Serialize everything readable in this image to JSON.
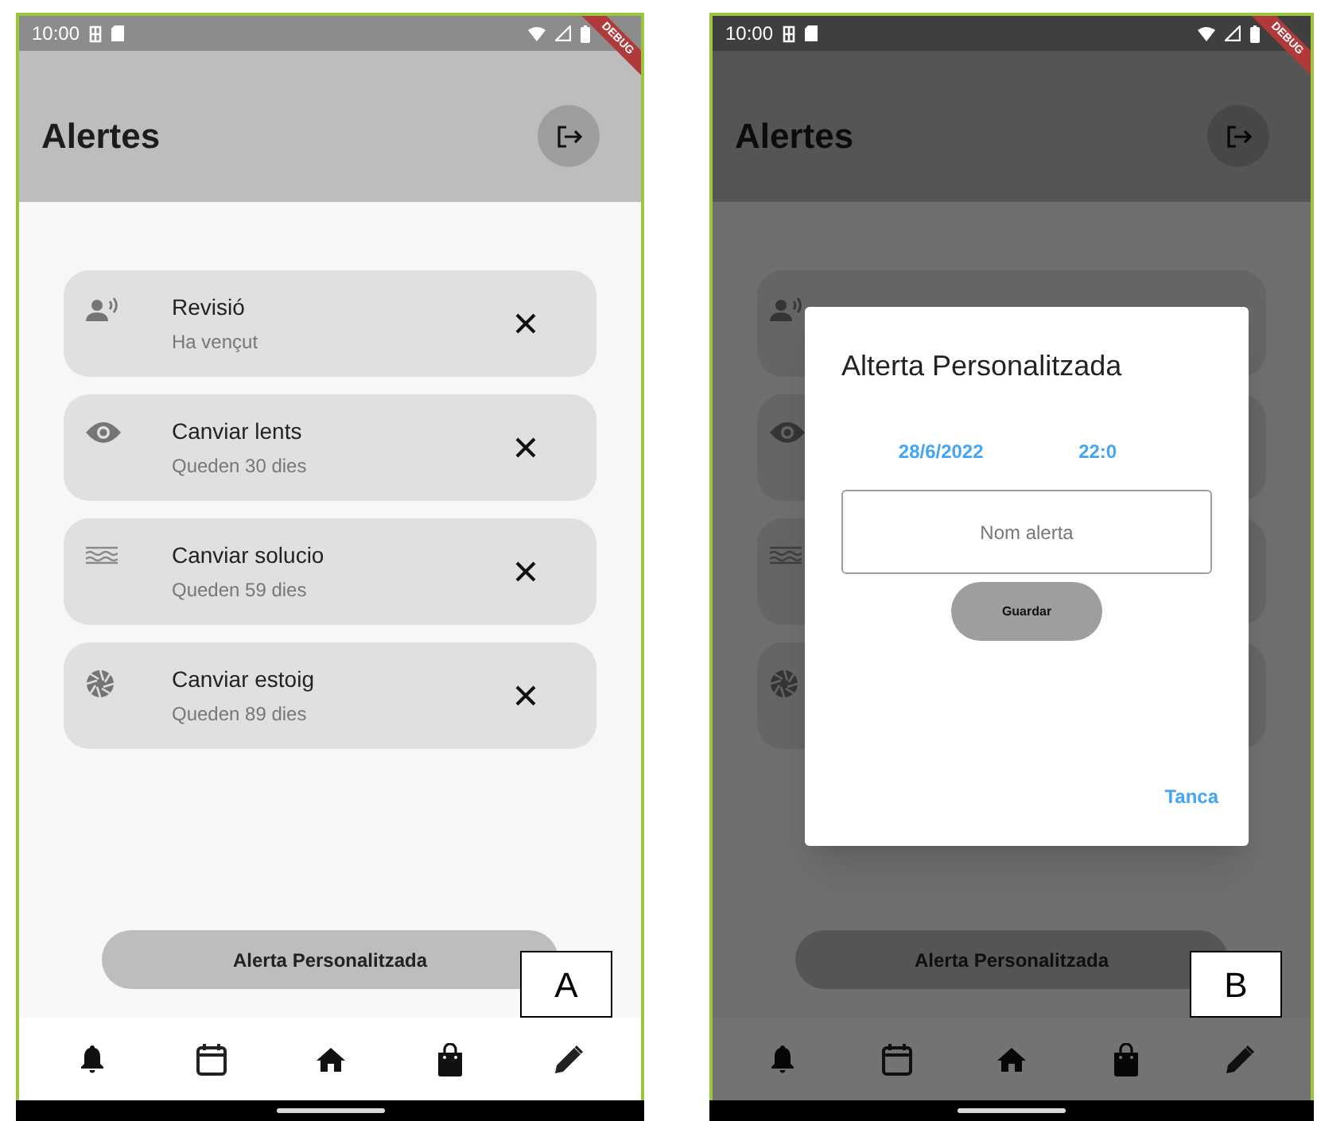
{
  "screens": [
    {
      "label": "A",
      "status_bar": {
        "time": "10:00"
      },
      "debug_banner": "DEBUG",
      "title": "Alertes",
      "alerts": [
        {
          "kind": "person",
          "title": "Revisió",
          "subtitle": "Ha vençut"
        },
        {
          "kind": "eye",
          "title": "Canviar lents",
          "subtitle": "Queden 30 dies"
        },
        {
          "kind": "waves",
          "title": "Canviar solucio",
          "subtitle": "Queden 59 dies"
        },
        {
          "kind": "aperture",
          "title": "Canviar estoig",
          "subtitle": "Queden 89 dies"
        }
      ],
      "action_button": "Alerta Personalitzada",
      "nav": [
        {
          "kind": "bell"
        },
        {
          "kind": "calendar"
        },
        {
          "kind": "home"
        },
        {
          "kind": "bag"
        },
        {
          "kind": "pencil"
        }
      ]
    },
    {
      "label": "B",
      "status_bar": {
        "time": "10:00"
      },
      "debug_banner": "DEBUG",
      "title": "Alertes",
      "alerts": [
        {
          "kind": "person"
        },
        {
          "kind": "eye"
        },
        {
          "kind": "waves"
        },
        {
          "kind": "aperture"
        }
      ],
      "action_button": "Alerta Personalitzada",
      "nav": [
        {
          "kind": "bell"
        },
        {
          "kind": "calendar"
        },
        {
          "kind": "home"
        },
        {
          "kind": "bag"
        },
        {
          "kind": "pencil"
        }
      ],
      "dialog": {
        "title": "Alterta Personalitzada",
        "date": "28/6/2022",
        "time": "22:0",
        "name_field": {
          "placeholder": "Nom alerta"
        },
        "save_button": "Guardar",
        "close_link": "Tanca"
      }
    }
  ]
}
